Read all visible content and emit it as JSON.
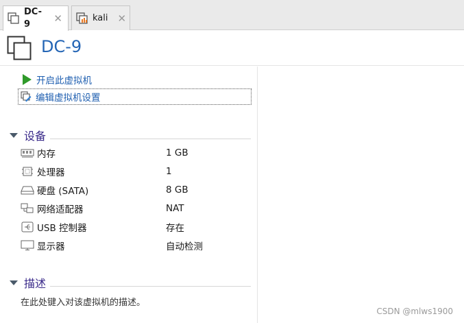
{
  "tabs": [
    {
      "label": "DC-9",
      "active": true,
      "icon": "vm-icon"
    },
    {
      "label": "kali",
      "active": false,
      "icon": "kali-vm-icon"
    }
  ],
  "vm": {
    "title": "DC-9"
  },
  "actions": {
    "power_on": "开启此虚拟机",
    "edit_settings": "编辑虚拟机设置"
  },
  "devices": {
    "heading": "设备",
    "items": [
      {
        "name": "内存",
        "value": "1 GB",
        "icon": "memory-icon"
      },
      {
        "name": "处理器",
        "value": "1",
        "icon": "cpu-icon"
      },
      {
        "name": "硬盘 (SATA)",
        "value": "8 GB",
        "icon": "hard-disk-icon"
      },
      {
        "name": "网络适配器",
        "value": "NAT",
        "icon": "network-adapter-icon"
      },
      {
        "name": "USB 控制器",
        "value": "存在",
        "icon": "usb-icon"
      },
      {
        "name": "显示器",
        "value": "自动检测",
        "icon": "monitor-icon"
      }
    ]
  },
  "description": {
    "heading": "描述",
    "placeholder": "在此处键入对该虚拟机的描述。"
  },
  "watermark": "CSDN @mlws1900",
  "colors": {
    "accent": "#2465b5",
    "play": "#2f9a2a",
    "heading": "#3a2a8a"
  }
}
